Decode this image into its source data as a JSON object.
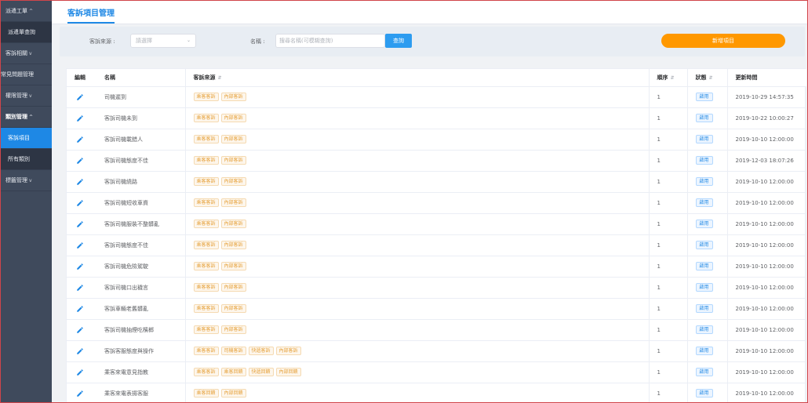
{
  "sidebar": {
    "items": [
      {
        "label": "派遣工單",
        "chevron": "^"
      },
      {
        "label": "派遣單查詢",
        "sub": true
      },
      {
        "label": "客訴相關",
        "chevron": "v"
      },
      {
        "label": "常見問題管理"
      },
      {
        "label": "權限管理",
        "chevron": "v"
      },
      {
        "label": "類別管理",
        "chevron": "^"
      },
      {
        "label": "客訴項目",
        "sub": true
      },
      {
        "label": "所有類別",
        "sub": true
      },
      {
        "label": "標籤管理",
        "chevron": "v"
      }
    ]
  },
  "header": {
    "page_tab": "客訴項目管理"
  },
  "filters": {
    "source_label": "客訴來源 :",
    "source_placeholder": "請選擇",
    "name_label": "名稱 :",
    "name_placeholder": "搜尋名稱(可模糊查詢)",
    "search_label": "查詢",
    "add_label": "新增項目"
  },
  "table": {
    "headers": {
      "edit": "編輯",
      "name": "名稱",
      "source": "客訴來源",
      "order": "順序",
      "status": "狀態",
      "updated": "更新時間"
    },
    "rows": [
      {
        "name": "司機遲到",
        "tags": [
          "乘客客訴",
          "內部客訴"
        ],
        "order": "1",
        "status": "啟用",
        "updated": "2019-10-29 14:57:35"
      },
      {
        "name": "客訴司機未到",
        "tags": [
          "乘客客訴",
          "內部客訴"
        ],
        "order": "1",
        "status": "啟用",
        "updated": "2019-10-22 10:00:27"
      },
      {
        "name": "客訴司機載錯人",
        "tags": [
          "乘客客訴",
          "內部客訴"
        ],
        "order": "1",
        "status": "啟用",
        "updated": "2019-10-10 12:00:00"
      },
      {
        "name": "客訴司機態度不佳",
        "tags": [
          "乘客客訴",
          "內部客訴"
        ],
        "order": "1",
        "status": "啟用",
        "updated": "2019-12-03 18:07:26"
      },
      {
        "name": "客訴司機繞路",
        "tags": [
          "乘客客訴",
          "內部客訴"
        ],
        "order": "1",
        "status": "啟用",
        "updated": "2019-10-10 12:00:00"
      },
      {
        "name": "客訴司機短收車資",
        "tags": [
          "乘客客訴",
          "內部客訴"
        ],
        "order": "1",
        "status": "啟用",
        "updated": "2019-10-10 12:00:00"
      },
      {
        "name": "客訴司機服裝不整髒亂",
        "tags": [
          "乘客客訴",
          "內部客訴"
        ],
        "order": "1",
        "status": "啟用",
        "updated": "2019-10-10 12:00:00"
      },
      {
        "name": "客訴司機態度不佳",
        "tags": [
          "乘客客訴",
          "內部客訴"
        ],
        "order": "1",
        "status": "啟用",
        "updated": "2019-10-10 12:00:00"
      },
      {
        "name": "客訴司機危險駕駛",
        "tags": [
          "乘客客訴",
          "內部客訴"
        ],
        "order": "1",
        "status": "啟用",
        "updated": "2019-10-10 12:00:00"
      },
      {
        "name": "客訴司機口出穢言",
        "tags": [
          "乘客客訴",
          "內部客訴"
        ],
        "order": "1",
        "status": "啟用",
        "updated": "2019-10-10 12:00:00"
      },
      {
        "name": "客訴車輛老舊髒亂",
        "tags": [
          "乘客客訴",
          "內部客訴"
        ],
        "order": "1",
        "status": "啟用",
        "updated": "2019-10-10 12:00:00"
      },
      {
        "name": "客訴司機抽煙吃檳榔",
        "tags": [
          "乘客客訴",
          "內部客訴"
        ],
        "order": "1",
        "status": "啟用",
        "updated": "2019-10-10 12:00:00"
      },
      {
        "name": "客訴客服態度與操作",
        "tags": [
          "乘客客訴",
          "司機客訴",
          "快遞客訴",
          "內部客訴"
        ],
        "order": "1",
        "status": "啟用",
        "updated": "2019-10-10 12:00:00"
      },
      {
        "name": "乘客來電意見指教",
        "tags": [
          "乘客客訴",
          "乘客回饋",
          "快遞回饋",
          "內部回饋"
        ],
        "order": "1",
        "status": "啟用",
        "updated": "2019-10-10 12:00:00"
      },
      {
        "name": "乘客來電表揚客服",
        "tags": [
          "乘客回饋",
          "內部回饋"
        ],
        "order": "1",
        "status": "啟用",
        "updated": "2019-10-10 12:00:00"
      }
    ]
  },
  "icons": {
    "edit": "pencil-icon",
    "dropdown": "chevron-down-icon",
    "sort": "sort-icon"
  },
  "colors": {
    "primary": "#1e88e5",
    "accent": "#ff9800",
    "sidebar": "#3f4a5c"
  }
}
